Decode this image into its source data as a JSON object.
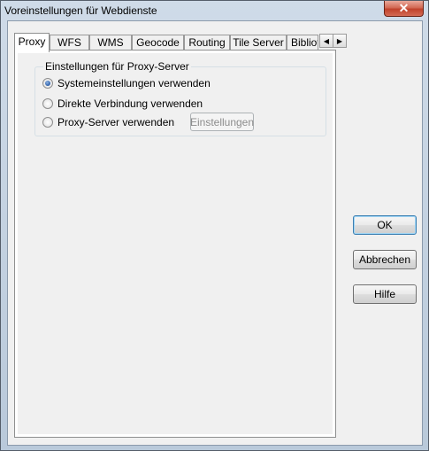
{
  "window": {
    "title": "Voreinstellungen für Webdienste",
    "close_glyph": "✕"
  },
  "tabs": [
    {
      "label": "Proxy",
      "active": true
    },
    {
      "label": "WFS"
    },
    {
      "label": "WMS"
    },
    {
      "label": "Geocode"
    },
    {
      "label": "Routing"
    },
    {
      "label": "Tile Server"
    },
    {
      "label": "Bibliothek"
    }
  ],
  "tab_scroll": {
    "left_glyph": "◀",
    "right_glyph": "▶"
  },
  "proxy": {
    "group_title": "Einstellungen für Proxy-Server",
    "options": [
      {
        "label": "Systemeinstellungen verwenden",
        "checked": true
      },
      {
        "label": "Direkte Verbindung verwenden",
        "checked": false
      },
      {
        "label": "Proxy-Server verwenden",
        "checked": false
      }
    ],
    "settings_button": "Einstellungen"
  },
  "buttons": {
    "ok": "OK",
    "cancel": "Abbrechen",
    "help": "Hilfe"
  },
  "colors": {
    "title_bar": "#b9c9da",
    "dialog_bg": "#f0f0f0",
    "close_button": "#c0422b"
  }
}
